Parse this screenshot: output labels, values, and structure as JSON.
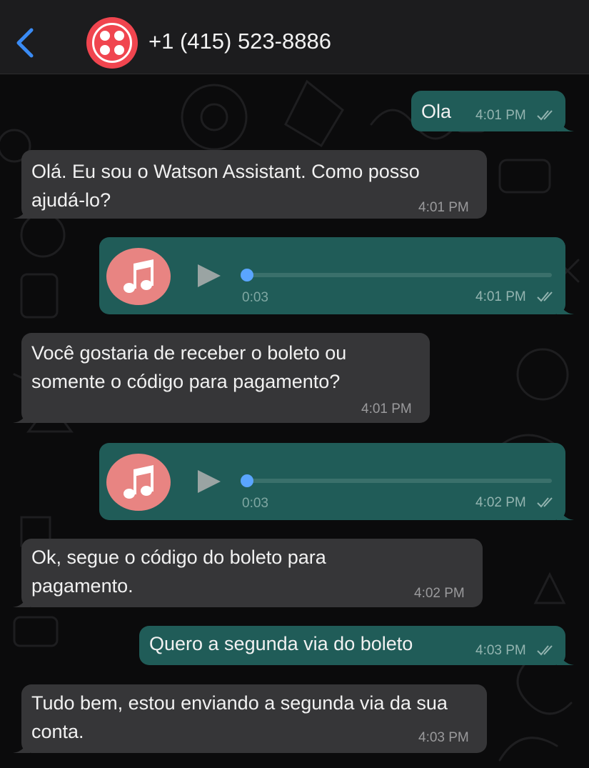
{
  "header": {
    "back_icon": "chevron-left-icon",
    "avatar_icon": "twilio-logo-icon",
    "contact": "+1 (415) 523-8886"
  },
  "colors": {
    "accent": "#3a8bf5",
    "header_bg": "#1c1c1e",
    "incoming_bubble": "#363638",
    "outgoing_bubble": "#205c58",
    "avatar": "#f0454f",
    "audio_avatar": "#e88482",
    "progress_dot": "#5aa5ff"
  },
  "messages": [
    {
      "direction": "out",
      "type": "text",
      "text": "Ola",
      "time": "4:01 PM",
      "status": "read"
    },
    {
      "direction": "in",
      "type": "text",
      "text": "Olá. Eu sou o Watson Assistant. Como posso ajudá-lo?",
      "time": "4:01 PM"
    },
    {
      "direction": "out",
      "type": "audio",
      "duration": "0:03",
      "progress": 0,
      "time": "4:01 PM",
      "status": "read",
      "icon": "music-note-icon"
    },
    {
      "direction": "in",
      "type": "text",
      "text": "Você gostaria de receber o boleto ou somente o código para pagamento?",
      "time": "4:01 PM"
    },
    {
      "direction": "out",
      "type": "audio",
      "duration": "0:03",
      "progress": 0,
      "time": "4:02 PM",
      "status": "read",
      "icon": "music-note-icon"
    },
    {
      "direction": "in",
      "type": "text",
      "text": "Ok, segue o código do boleto para pagamento.",
      "time": "4:02 PM"
    },
    {
      "direction": "out",
      "type": "text",
      "text": "Quero a segunda via do boleto",
      "time": "4:03 PM",
      "status": "read"
    },
    {
      "direction": "in",
      "type": "text",
      "text": "Tudo bem, estou enviando a segunda via da sua conta.",
      "time": "4:03 PM"
    }
  ]
}
